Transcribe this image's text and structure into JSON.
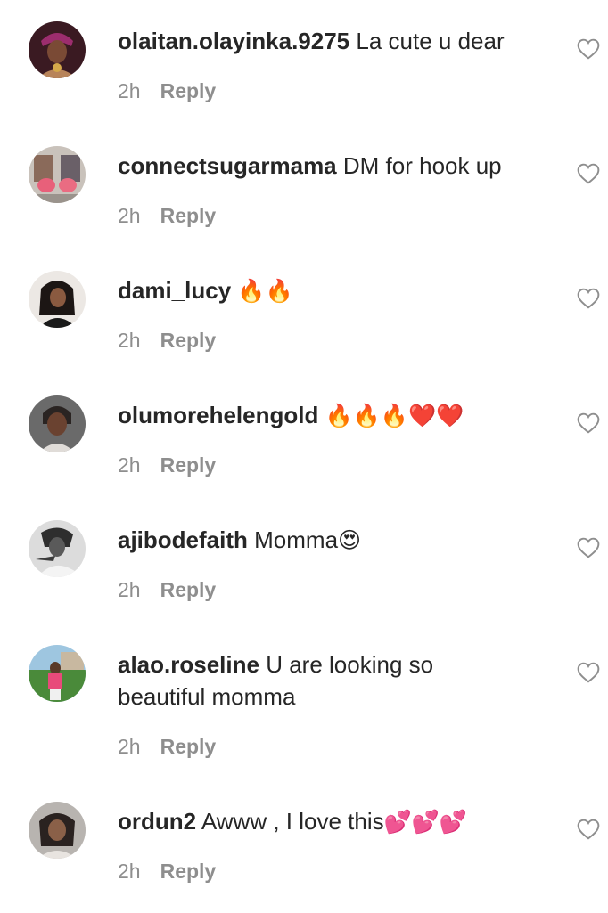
{
  "comments": [
    {
      "username": "olaitan.olayinka.9275",
      "text": "La cute u dear",
      "emoji": "",
      "time": "2h",
      "reply_label": "Reply"
    },
    {
      "username": "connectsugarmama",
      "text": "DM for hook up",
      "emoji": "",
      "time": "2h",
      "reply_label": "Reply"
    },
    {
      "username": "dami_lucy",
      "text": "",
      "emoji": "🔥🔥",
      "time": "2h",
      "reply_label": "Reply"
    },
    {
      "username": "olumorehelengold",
      "text": "",
      "emoji": "🔥🔥🔥❤️❤️",
      "time": "2h",
      "reply_label": "Reply"
    },
    {
      "username": "ajibodefaith",
      "text": "Momma",
      "emoji": "😍",
      "time": "2h",
      "reply_label": "Reply"
    },
    {
      "username": "alao.roseline",
      "text": "U are looking so beautiful momma",
      "emoji": "",
      "time": "2h",
      "reply_label": "Reply"
    },
    {
      "username": "ordun2",
      "text": "Awww , I love this",
      "emoji": "💕💕💕",
      "time": "2h",
      "reply_label": "Reply"
    }
  ],
  "icons": {
    "like": "heart-outline-icon"
  },
  "colors": {
    "text": "#262626",
    "secondary": "#8e8e8e",
    "background": "#ffffff"
  }
}
